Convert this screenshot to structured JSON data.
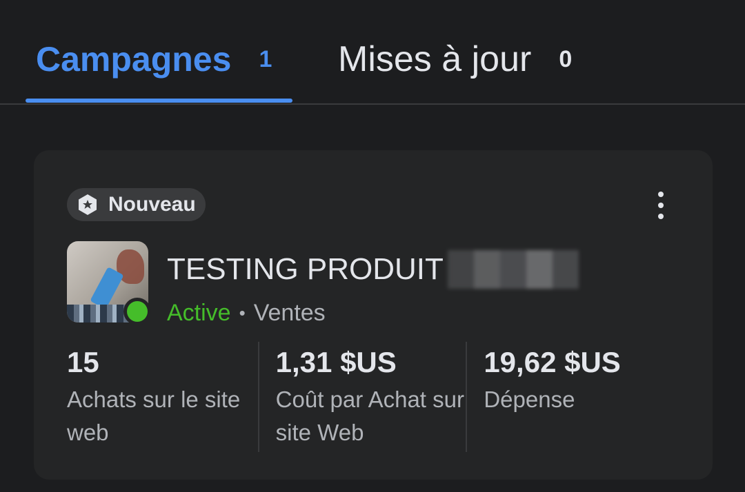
{
  "tabs": [
    {
      "label": "Campagnes",
      "count": "1",
      "active": true
    },
    {
      "label": "Mises à jour",
      "count": "0",
      "active": false
    }
  ],
  "card": {
    "badge": {
      "icon": "badge-star-icon",
      "label": "Nouveau"
    },
    "more_icon": "more-vertical-icon",
    "campaign_name": "TESTING PRODUIT",
    "status": "Active",
    "separator": "•",
    "objective": "Ventes",
    "metrics": [
      {
        "value": "15",
        "label": "Achats sur le site web"
      },
      {
        "value": "1,31 $US",
        "label": "Coût par Achat sur site Web"
      },
      {
        "value": "19,62 $US",
        "label": "Dépense"
      }
    ]
  },
  "colors": {
    "accent": "#4a8ef0",
    "active_status": "#45bd2a",
    "background": "#1c1d1f",
    "card": "#242526"
  }
}
